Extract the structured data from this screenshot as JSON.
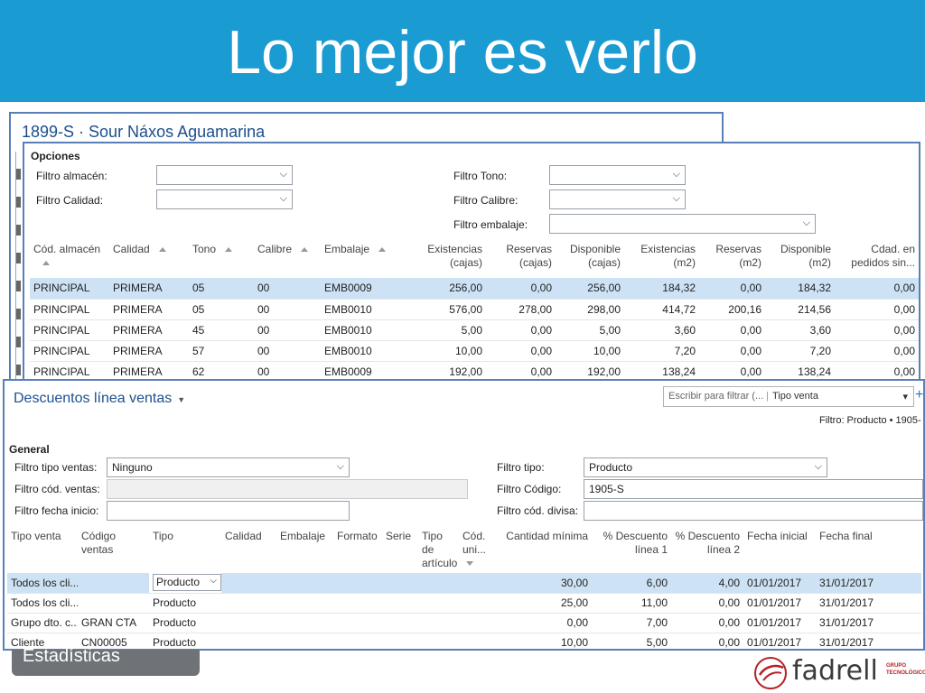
{
  "slide": {
    "title": "Lo mejor es verlo",
    "footer_button": "Estadísticas"
  },
  "product_window": {
    "title": "1899-S · Sour Náxos Aguamarina"
  },
  "options": {
    "title": "Opciones",
    "filters": {
      "almacen": {
        "label": "Filtro almacén:",
        "value": ""
      },
      "calidad": {
        "label": "Filtro Calidad:",
        "value": ""
      },
      "tono": {
        "label": "Filtro Tono:",
        "value": ""
      },
      "calibre": {
        "label": "Filtro Calibre:",
        "value": ""
      },
      "embalaje": {
        "label": "Filtro embalaje:",
        "value": ""
      }
    },
    "columns": [
      "Cód. almacén",
      "Calidad",
      "Tono",
      "Calibre",
      "Embalaje",
      "Existencias (cajas)",
      "Reservas (cajas)",
      "Disponible (cajas)",
      "Existencias (m2)",
      "Reservas (m2)",
      "Disponible (m2)",
      "Cdad. en pedidos sin..."
    ],
    "rows": [
      [
        "PRINCIPAL",
        "PRIMERA",
        "05",
        "00",
        "EMB0009",
        "256,00",
        "0,00",
        "256,00",
        "184,32",
        "0,00",
        "184,32",
        "0,00"
      ],
      [
        "PRINCIPAL",
        "PRIMERA",
        "05",
        "00",
        "EMB0010",
        "576,00",
        "278,00",
        "298,00",
        "414,72",
        "200,16",
        "214,56",
        "0,00"
      ],
      [
        "PRINCIPAL",
        "PRIMERA",
        "45",
        "00",
        "EMB0010",
        "5,00",
        "0,00",
        "5,00",
        "3,60",
        "0,00",
        "3,60",
        "0,00"
      ],
      [
        "PRINCIPAL",
        "PRIMERA",
        "57",
        "00",
        "EMB0010",
        "10,00",
        "0,00",
        "10,00",
        "7,20",
        "0,00",
        "7,20",
        "0,00"
      ],
      [
        "PRINCIPAL",
        "PRIMERA",
        "62",
        "00",
        "EMB0009",
        "192,00",
        "0,00",
        "192,00",
        "138,24",
        "0,00",
        "138,24",
        "0,00"
      ]
    ]
  },
  "discounts": {
    "title": "Descuentos línea ventas",
    "search": {
      "placeholder": "Escribir para filtrar (...",
      "field": "Tipo venta"
    },
    "filter_text": "Filtro: Producto • 1905-",
    "general": {
      "title": "General",
      "tipo_ventas": {
        "label": "Filtro tipo ventas:",
        "value": "Ninguno"
      },
      "cod_ventas": {
        "label": "Filtro cód. ventas:",
        "value": ""
      },
      "fecha_inicio": {
        "label": "Filtro fecha inicio:",
        "value": ""
      },
      "tipo": {
        "label": "Filtro tipo:",
        "value": "Producto"
      },
      "codigo": {
        "label": "Filtro Código:",
        "value": "1905-S"
      },
      "divisa": {
        "label": "Filtro cód. divisa:",
        "value": ""
      }
    },
    "columns": [
      "Tipo venta",
      "Código ventas",
      "Tipo",
      "Calidad",
      "Embalaje",
      "Formato",
      "Serie",
      "Tipo de artículo",
      "Cód. uni...",
      "Cantidad mínima",
      "% Descuento línea 1",
      "% Descuento línea 2",
      "Fecha inicial",
      "Fecha final"
    ],
    "rows": [
      [
        "Todos los cli...",
        "",
        "Producto",
        "",
        "",
        "",
        "",
        "",
        "",
        "30,00",
        "6,00",
        "4,00",
        "01/01/2017",
        "31/01/2017"
      ],
      [
        "Todos los cli...",
        "",
        "Producto",
        "",
        "",
        "",
        "",
        "",
        "",
        "25,00",
        "11,00",
        "0,00",
        "01/01/2017",
        "31/01/2017"
      ],
      [
        "Grupo dto. c...",
        "GRAN CTA",
        "Producto",
        "",
        "",
        "",
        "",
        "",
        "",
        "0,00",
        "7,00",
        "0,00",
        "01/01/2017",
        "31/01/2017"
      ],
      [
        "Cliente",
        "CN00005",
        "Producto",
        "",
        "",
        "",
        "",
        "",
        "",
        "10,00",
        "5,00",
        "0,00",
        "01/01/2017",
        "31/01/2017"
      ]
    ]
  },
  "logo": {
    "name": "fadrell",
    "tagline": "GRUPO TECNOLÓGICO"
  },
  "colors": {
    "banner": "#1a9bd2",
    "window_border": "#5a7fb8",
    "selected_row": "#cde3f5"
  }
}
